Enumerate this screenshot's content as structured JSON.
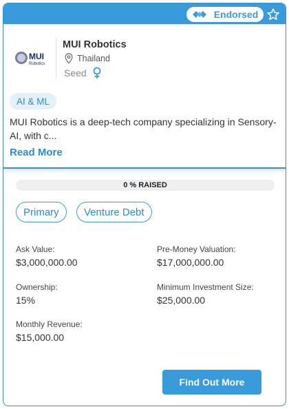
{
  "header": {
    "badge_label": "Endorsed",
    "accent_color": "#3a9bdc"
  },
  "company": {
    "logo_text": "MUI",
    "logo_subtext": "Robotics",
    "name": "MUI Robotics",
    "location": "Thailand",
    "stage": "Seed",
    "sector_tag": "AI & ML",
    "description": "MUI Robotics is a deep-tech company specializing in Sensory-AI, with c...",
    "read_more_label": "Read More"
  },
  "funding": {
    "progress_label": "0 % RAISED",
    "raised_fraction": 0,
    "types": [
      "Primary",
      "Venture Debt"
    ]
  },
  "metrics": {
    "ask_value": {
      "label": "Ask Value:",
      "value": "$3,000,000.00"
    },
    "pre_money": {
      "label": "Pre-Money Valuation:",
      "value": "$17,000,000.00"
    },
    "ownership": {
      "label": "Ownership:",
      "value": "15%"
    },
    "min_investment": {
      "label": "Minimum Investment Size:",
      "value": "$25,000.00"
    },
    "monthly_revenue": {
      "label": "Monthly Revenue:",
      "value": "$15,000.00"
    }
  },
  "actions": {
    "find_out_more_label": "Find Out More"
  }
}
